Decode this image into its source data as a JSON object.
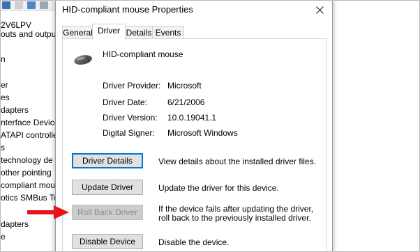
{
  "background": {
    "partial_header": "2V6LPV",
    "tree_items": [
      "outs and outpu",
      "n",
      "er",
      "es",
      "dapters",
      "nterface Device",
      "ATAPI controlle",
      "s",
      "technology de",
      " other pointing",
      "compliant mou",
      "otics SMBus To",
      "",
      "dapters",
      "e"
    ]
  },
  "dialog": {
    "title": "HID-compliant mouse Properties",
    "tabs": [
      {
        "label": "General",
        "active": false
      },
      {
        "label": "Driver",
        "active": true
      },
      {
        "label": "Details",
        "active": false
      },
      {
        "label": "Events",
        "active": false
      }
    ],
    "device_name": "HID-compliant mouse",
    "info": [
      {
        "label": "Driver Provider:",
        "value": "Microsoft"
      },
      {
        "label": "Driver Date:",
        "value": "6/21/2006"
      },
      {
        "label": "Driver Version:",
        "value": "10.0.19041.1"
      },
      {
        "label": "Digital Signer:",
        "value": "Microsoft Windows"
      }
    ],
    "buttons": [
      {
        "label": "Driver Details",
        "desc": "View details about the installed driver files.",
        "focused": true,
        "disabled": false
      },
      {
        "label": "Update Driver",
        "desc": "Update the driver for this device.",
        "focused": false,
        "disabled": false
      },
      {
        "label": "Roll Back Driver",
        "desc": "If the device fails after updating the driver, roll back to the previously installed driver.",
        "focused": false,
        "disabled": true
      },
      {
        "label": "Disable Device",
        "desc": "Disable the device.",
        "focused": false,
        "disabled": false
      }
    ]
  },
  "colors": {
    "arrow": "#e8141b",
    "focus": "#0078d7"
  }
}
